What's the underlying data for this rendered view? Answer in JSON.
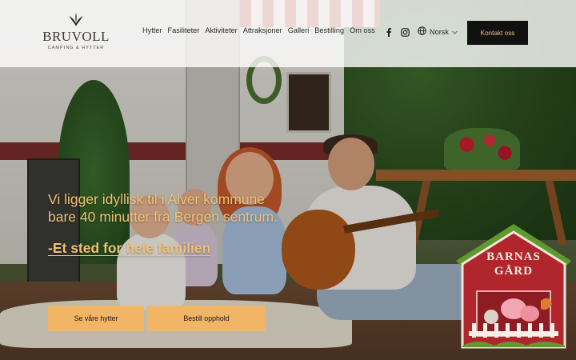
{
  "brand": {
    "name": "BRUVOLL",
    "tagline": "CAMPING & HYTTER"
  },
  "nav": {
    "items": [
      "Hytter",
      "Fasiliteter",
      "Aktiviteter",
      "Attraksjoner",
      "Galleri",
      "Bestilling",
      "Om oss"
    ]
  },
  "social": {
    "icons": [
      "facebook-icon",
      "instagram-icon"
    ]
  },
  "language": {
    "label": "Norsk",
    "icon": "globe-icon"
  },
  "header_cta": {
    "label": "Kontakt oss"
  },
  "hero": {
    "headline_line1": "Vi ligger idyllisk til i Alver kommune",
    "headline_line2": "bare 40 minutter fra Bergen sentrum.",
    "tagline": "-Et sted for hele familien",
    "primary_button": "Se våre hytter",
    "secondary_button": "Bestill opphold"
  },
  "badge": {
    "line1": "BARNAS",
    "line2": "GÅRD"
  },
  "colors": {
    "accent": "#f2b565",
    "headline": "#f0c072",
    "cta_bg": "#111111",
    "cta_text": "#f1c27a",
    "barn_red": "#b0262c"
  }
}
